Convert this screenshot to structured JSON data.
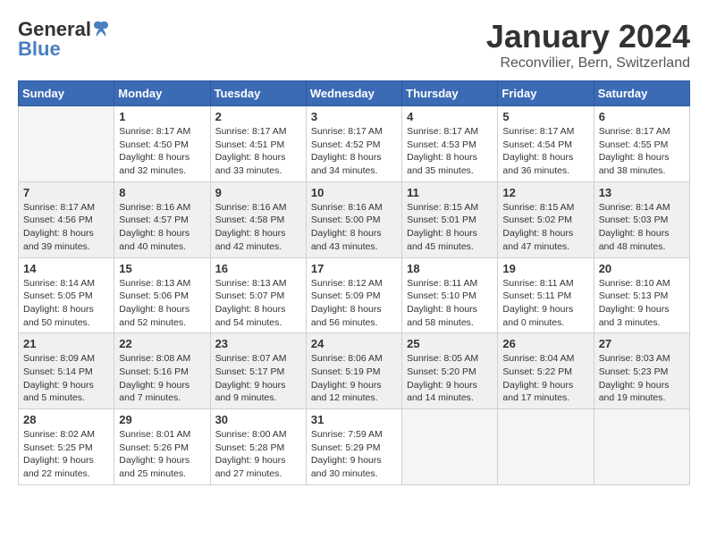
{
  "logo": {
    "general": "General",
    "blue": "Blue"
  },
  "title": "January 2024",
  "location": "Reconvilier, Bern, Switzerland",
  "days_of_week": [
    "Sunday",
    "Monday",
    "Tuesday",
    "Wednesday",
    "Thursday",
    "Friday",
    "Saturday"
  ],
  "weeks": [
    [
      {
        "day": "",
        "info": ""
      },
      {
        "day": "1",
        "info": "Sunrise: 8:17 AM\nSunset: 4:50 PM\nDaylight: 8 hours\nand 32 minutes."
      },
      {
        "day": "2",
        "info": "Sunrise: 8:17 AM\nSunset: 4:51 PM\nDaylight: 8 hours\nand 33 minutes."
      },
      {
        "day": "3",
        "info": "Sunrise: 8:17 AM\nSunset: 4:52 PM\nDaylight: 8 hours\nand 34 minutes."
      },
      {
        "day": "4",
        "info": "Sunrise: 8:17 AM\nSunset: 4:53 PM\nDaylight: 8 hours\nand 35 minutes."
      },
      {
        "day": "5",
        "info": "Sunrise: 8:17 AM\nSunset: 4:54 PM\nDaylight: 8 hours\nand 36 minutes."
      },
      {
        "day": "6",
        "info": "Sunrise: 8:17 AM\nSunset: 4:55 PM\nDaylight: 8 hours\nand 38 minutes."
      }
    ],
    [
      {
        "day": "7",
        "info": "Sunrise: 8:17 AM\nSunset: 4:56 PM\nDaylight: 8 hours\nand 39 minutes."
      },
      {
        "day": "8",
        "info": "Sunrise: 8:16 AM\nSunset: 4:57 PM\nDaylight: 8 hours\nand 40 minutes."
      },
      {
        "day": "9",
        "info": "Sunrise: 8:16 AM\nSunset: 4:58 PM\nDaylight: 8 hours\nand 42 minutes."
      },
      {
        "day": "10",
        "info": "Sunrise: 8:16 AM\nSunset: 5:00 PM\nDaylight: 8 hours\nand 43 minutes."
      },
      {
        "day": "11",
        "info": "Sunrise: 8:15 AM\nSunset: 5:01 PM\nDaylight: 8 hours\nand 45 minutes."
      },
      {
        "day": "12",
        "info": "Sunrise: 8:15 AM\nSunset: 5:02 PM\nDaylight: 8 hours\nand 47 minutes."
      },
      {
        "day": "13",
        "info": "Sunrise: 8:14 AM\nSunset: 5:03 PM\nDaylight: 8 hours\nand 48 minutes."
      }
    ],
    [
      {
        "day": "14",
        "info": "Sunrise: 8:14 AM\nSunset: 5:05 PM\nDaylight: 8 hours\nand 50 minutes."
      },
      {
        "day": "15",
        "info": "Sunrise: 8:13 AM\nSunset: 5:06 PM\nDaylight: 8 hours\nand 52 minutes."
      },
      {
        "day": "16",
        "info": "Sunrise: 8:13 AM\nSunset: 5:07 PM\nDaylight: 8 hours\nand 54 minutes."
      },
      {
        "day": "17",
        "info": "Sunrise: 8:12 AM\nSunset: 5:09 PM\nDaylight: 8 hours\nand 56 minutes."
      },
      {
        "day": "18",
        "info": "Sunrise: 8:11 AM\nSunset: 5:10 PM\nDaylight: 8 hours\nand 58 minutes."
      },
      {
        "day": "19",
        "info": "Sunrise: 8:11 AM\nSunset: 5:11 PM\nDaylight: 9 hours\nand 0 minutes."
      },
      {
        "day": "20",
        "info": "Sunrise: 8:10 AM\nSunset: 5:13 PM\nDaylight: 9 hours\nand 3 minutes."
      }
    ],
    [
      {
        "day": "21",
        "info": "Sunrise: 8:09 AM\nSunset: 5:14 PM\nDaylight: 9 hours\nand 5 minutes."
      },
      {
        "day": "22",
        "info": "Sunrise: 8:08 AM\nSunset: 5:16 PM\nDaylight: 9 hours\nand 7 minutes."
      },
      {
        "day": "23",
        "info": "Sunrise: 8:07 AM\nSunset: 5:17 PM\nDaylight: 9 hours\nand 9 minutes."
      },
      {
        "day": "24",
        "info": "Sunrise: 8:06 AM\nSunset: 5:19 PM\nDaylight: 9 hours\nand 12 minutes."
      },
      {
        "day": "25",
        "info": "Sunrise: 8:05 AM\nSunset: 5:20 PM\nDaylight: 9 hours\nand 14 minutes."
      },
      {
        "day": "26",
        "info": "Sunrise: 8:04 AM\nSunset: 5:22 PM\nDaylight: 9 hours\nand 17 minutes."
      },
      {
        "day": "27",
        "info": "Sunrise: 8:03 AM\nSunset: 5:23 PM\nDaylight: 9 hours\nand 19 minutes."
      }
    ],
    [
      {
        "day": "28",
        "info": "Sunrise: 8:02 AM\nSunset: 5:25 PM\nDaylight: 9 hours\nand 22 minutes."
      },
      {
        "day": "29",
        "info": "Sunrise: 8:01 AM\nSunset: 5:26 PM\nDaylight: 9 hours\nand 25 minutes."
      },
      {
        "day": "30",
        "info": "Sunrise: 8:00 AM\nSunset: 5:28 PM\nDaylight: 9 hours\nand 27 minutes."
      },
      {
        "day": "31",
        "info": "Sunrise: 7:59 AM\nSunset: 5:29 PM\nDaylight: 9 hours\nand 30 minutes."
      },
      {
        "day": "",
        "info": ""
      },
      {
        "day": "",
        "info": ""
      },
      {
        "day": "",
        "info": ""
      }
    ]
  ]
}
